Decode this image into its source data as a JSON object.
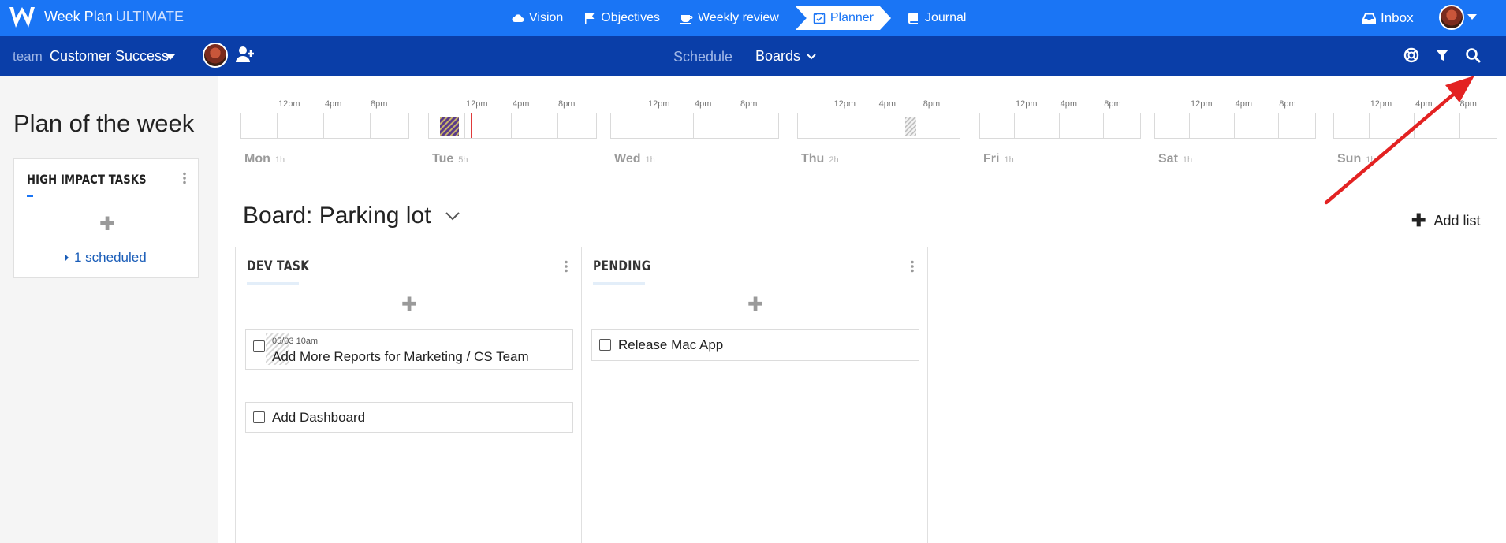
{
  "brand": {
    "name": "Week Plan",
    "tier": "ULTIMATE"
  },
  "topnav": {
    "links": [
      {
        "label": "Vision",
        "icon": "cloud-icon"
      },
      {
        "label": "Objectives",
        "icon": "flag-icon"
      },
      {
        "label": "Weekly review",
        "icon": "coffee-cup-icon"
      },
      {
        "label": "Planner",
        "icon": "calendar-check-icon",
        "active": true
      },
      {
        "label": "Journal",
        "icon": "book-icon"
      }
    ],
    "inbox_label": "Inbox"
  },
  "subbar": {
    "team_label": "team",
    "team_name": "Customer Success",
    "schedule_label": "Schedule",
    "boards_label": "Boards"
  },
  "left": {
    "title": "Plan of the week",
    "card_title": "HIGH IMPACT TASKS",
    "scheduled_label": "1 scheduled"
  },
  "week": {
    "tick_labels": [
      "12pm",
      "4pm",
      "8pm"
    ],
    "days": [
      {
        "name": "Mon",
        "hours": "1h"
      },
      {
        "name": "Tue",
        "hours": "5h"
      },
      {
        "name": "Wed",
        "hours": "1h"
      },
      {
        "name": "Thu",
        "hours": "2h"
      },
      {
        "name": "Fri",
        "hours": "1h"
      },
      {
        "name": "Sat",
        "hours": "1h"
      },
      {
        "name": "Sun",
        "hours": "1h"
      }
    ]
  },
  "board": {
    "title": "Board: Parking lot",
    "add_list_label": "Add list",
    "lists": [
      {
        "title": "DEV TASK",
        "tasks": [
          {
            "due": "05/03 10am",
            "label": "Add More Reports for Marketing / CS Team"
          },
          {
            "label": "Add Dashboard"
          }
        ]
      },
      {
        "title": "PENDING",
        "tasks": [
          {
            "label": "Release Mac App"
          }
        ]
      }
    ]
  },
  "colors": {
    "topnav": "#1a75f5",
    "subbar": "#0a3ea8",
    "arrow": "#e32222"
  }
}
